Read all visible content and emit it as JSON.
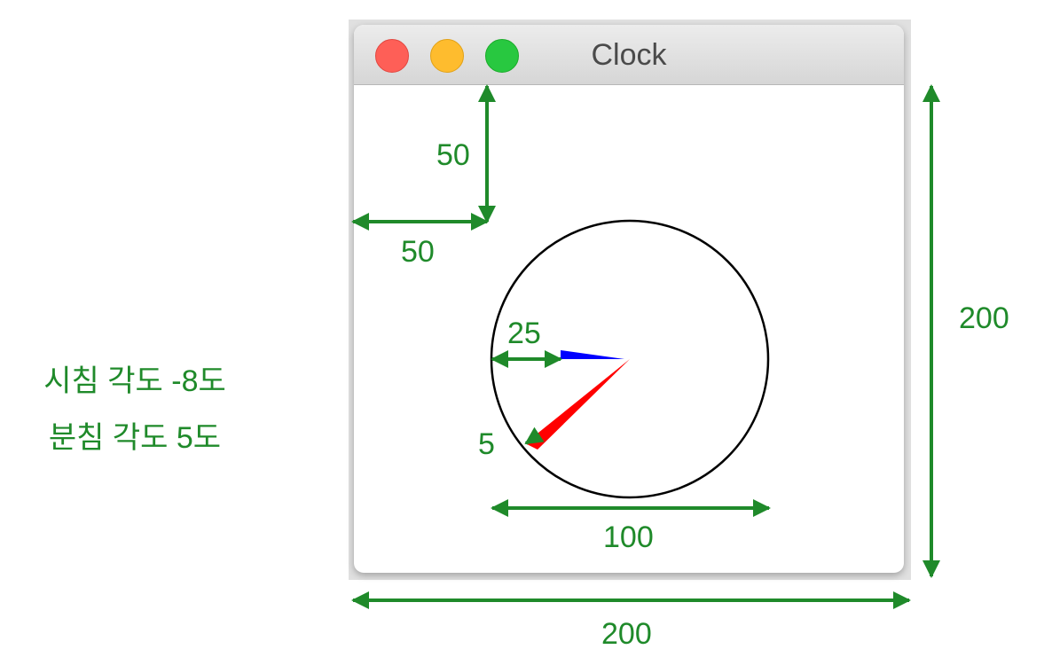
{
  "window": {
    "title": "Clock",
    "buttons": [
      "close",
      "minimize",
      "maximize"
    ]
  },
  "dimensions": {
    "top_margin": "50",
    "left_margin": "50",
    "minute_tip_inset": "25",
    "hour_tip_inset": "5",
    "clock_diameter": "100",
    "window_height": "200",
    "window_width": "200"
  },
  "info": {
    "hour_hand_angle": "시침 각도 -8도",
    "minute_hand_angle": "분침 각도 5도"
  },
  "colors": {
    "annotation": "#1f8a2a",
    "hour_hand": "#ff0000",
    "minute_hand": "#0000ff",
    "clock_face": "#000000"
  }
}
